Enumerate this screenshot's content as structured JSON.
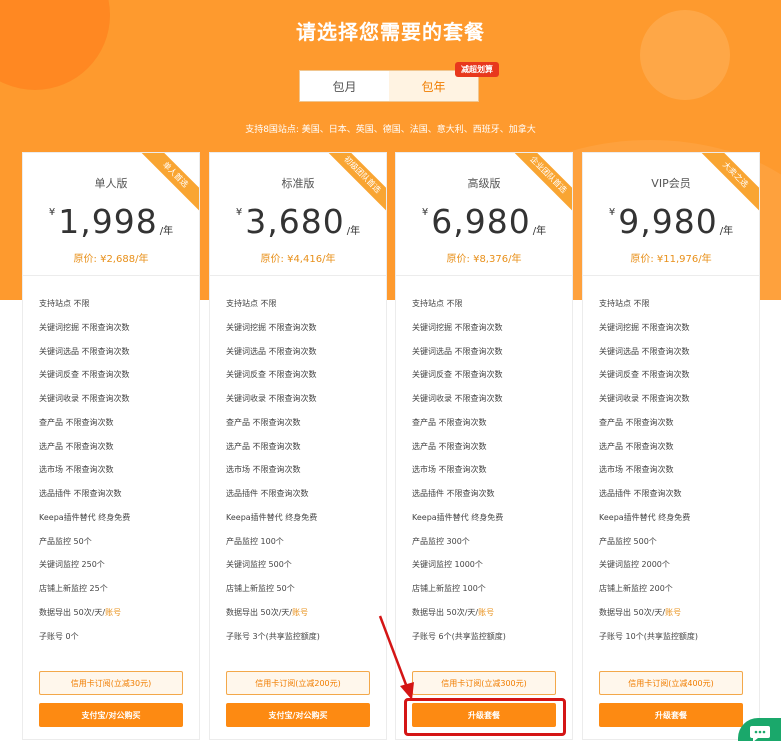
{
  "header": {
    "title": "请选择您需要的套餐",
    "tabs": [
      {
        "label": "包月"
      },
      {
        "label": "包年"
      }
    ],
    "promo_tag": "减超划算",
    "sites_text": "支持8国站点: 美国、日本、英国、德国、法国、意大利、西班牙、加拿大"
  },
  "plans": [
    {
      "name": "单人版",
      "ribbon": "单人首选",
      "currency": "¥",
      "price": "1,998",
      "unit": "/年",
      "original_price": "原价: ¥2,688/年",
      "features": [
        {
          "text": "支持站点 不限",
          "accent": ""
        },
        {
          "text": "关键词挖掘 不限查询次数",
          "accent": ""
        },
        {
          "text": "关键词选品 不限查询次数",
          "accent": ""
        },
        {
          "text": "关键词反查 不限查询次数",
          "accent": ""
        },
        {
          "text": "关键词收录 不限查询次数",
          "accent": ""
        },
        {
          "text": "查产品 不限查询次数",
          "accent": ""
        },
        {
          "text": "选产品 不限查询次数",
          "accent": ""
        },
        {
          "text": "选市场 不限查询次数",
          "accent": ""
        },
        {
          "text": "选品插件 不限查询次数",
          "accent": ""
        },
        {
          "text": "Keepa插件替代 终身免费",
          "accent": ""
        },
        {
          "text": "产品监控 50个",
          "accent": ""
        },
        {
          "text": "关键词监控 250个",
          "accent": ""
        },
        {
          "text": "店铺上新监控 25个",
          "accent": ""
        },
        {
          "text": "数据导出 50次/天/",
          "accent": "账号"
        },
        {
          "text": "子账号 0个",
          "accent": ""
        }
      ],
      "btn_outline": "信用卡订阅(立减30元)",
      "btn_solid": "支付宝/对公购买"
    },
    {
      "name": "标准版",
      "ribbon": "初级团队首选",
      "currency": "¥",
      "price": "3,680",
      "unit": "/年",
      "original_price": "原价: ¥4,416/年",
      "features": [
        {
          "text": "支持站点 不限",
          "accent": ""
        },
        {
          "text": "关键词挖掘 不限查询次数",
          "accent": ""
        },
        {
          "text": "关键词选品 不限查询次数",
          "accent": ""
        },
        {
          "text": "关键词反查 不限查询次数",
          "accent": ""
        },
        {
          "text": "关键词收录 不限查询次数",
          "accent": ""
        },
        {
          "text": "查产品 不限查询次数",
          "accent": ""
        },
        {
          "text": "选产品 不限查询次数",
          "accent": ""
        },
        {
          "text": "选市场 不限查询次数",
          "accent": ""
        },
        {
          "text": "选品插件 不限查询次数",
          "accent": ""
        },
        {
          "text": "Keepa插件替代 终身免费",
          "accent": ""
        },
        {
          "text": "产品监控 100个",
          "accent": ""
        },
        {
          "text": "关键词监控 500个",
          "accent": ""
        },
        {
          "text": "店铺上新监控 50个",
          "accent": ""
        },
        {
          "text": "数据导出 50次/天/",
          "accent": "账号"
        },
        {
          "text": "子账号 3个(共享监控额度)",
          "accent": ""
        }
      ],
      "btn_outline": "信用卡订阅(立减200元)",
      "btn_solid": "支付宝/对公购买"
    },
    {
      "name": "高级版",
      "ribbon": "企业团队首选",
      "currency": "¥",
      "price": "6,980",
      "unit": "/年",
      "original_price": "原价: ¥8,376/年",
      "features": [
        {
          "text": "支持站点 不限",
          "accent": ""
        },
        {
          "text": "关键词挖掘 不限查询次数",
          "accent": ""
        },
        {
          "text": "关键词选品 不限查询次数",
          "accent": ""
        },
        {
          "text": "关键词反查 不限查询次数",
          "accent": ""
        },
        {
          "text": "关键词收录 不限查询次数",
          "accent": ""
        },
        {
          "text": "查产品 不限查询次数",
          "accent": ""
        },
        {
          "text": "选产品 不限查询次数",
          "accent": ""
        },
        {
          "text": "选市场 不限查询次数",
          "accent": ""
        },
        {
          "text": "选品插件 不限查询次数",
          "accent": ""
        },
        {
          "text": "Keepa插件替代 终身免费",
          "accent": ""
        },
        {
          "text": "产品监控 300个",
          "accent": ""
        },
        {
          "text": "关键词监控 1000个",
          "accent": ""
        },
        {
          "text": "店铺上新监控 100个",
          "accent": ""
        },
        {
          "text": "数据导出 50次/天/",
          "accent": "账号"
        },
        {
          "text": "子账号 6个(共享监控额度)",
          "accent": ""
        }
      ],
      "btn_outline": "信用卡订阅(立减300元)",
      "btn_solid": "升级套餐"
    },
    {
      "name": "VIP会员",
      "ribbon": "大卖之选",
      "currency": "¥",
      "price": "9,980",
      "unit": "/年",
      "original_price": "原价: ¥11,976/年",
      "features": [
        {
          "text": "支持站点 不限",
          "accent": ""
        },
        {
          "text": "关键词挖掘 不限查询次数",
          "accent": ""
        },
        {
          "text": "关键词选品 不限查询次数",
          "accent": ""
        },
        {
          "text": "关键词反查 不限查询次数",
          "accent": ""
        },
        {
          "text": "关键词收录 不限查询次数",
          "accent": ""
        },
        {
          "text": "查产品 不限查询次数",
          "accent": ""
        },
        {
          "text": "选产品 不限查询次数",
          "accent": ""
        },
        {
          "text": "选市场 不限查询次数",
          "accent": ""
        },
        {
          "text": "选品插件 不限查询次数",
          "accent": ""
        },
        {
          "text": "Keepa插件替代 终身免费",
          "accent": ""
        },
        {
          "text": "产品监控 500个",
          "accent": ""
        },
        {
          "text": "关键词监控 2000个",
          "accent": ""
        },
        {
          "text": "店铺上新监控 200个",
          "accent": ""
        },
        {
          "text": "数据导出 50次/天/",
          "accent": "账号"
        },
        {
          "text": "子账号 10个(共享监控额度)",
          "accent": ""
        }
      ],
      "btn_outline": "信用卡订阅(立减400元)",
      "btn_solid": "升级套餐"
    }
  ],
  "colors": {
    "brand_orange": "#fe9a2e",
    "button_orange": "#fd8a12",
    "price_accent": "#e8901a",
    "highlight_red": "#d41515",
    "chat_green": "#1aa86b"
  },
  "icons": {
    "chat": "chat-bubble-icon",
    "annotation": "red-arrow-icon"
  }
}
